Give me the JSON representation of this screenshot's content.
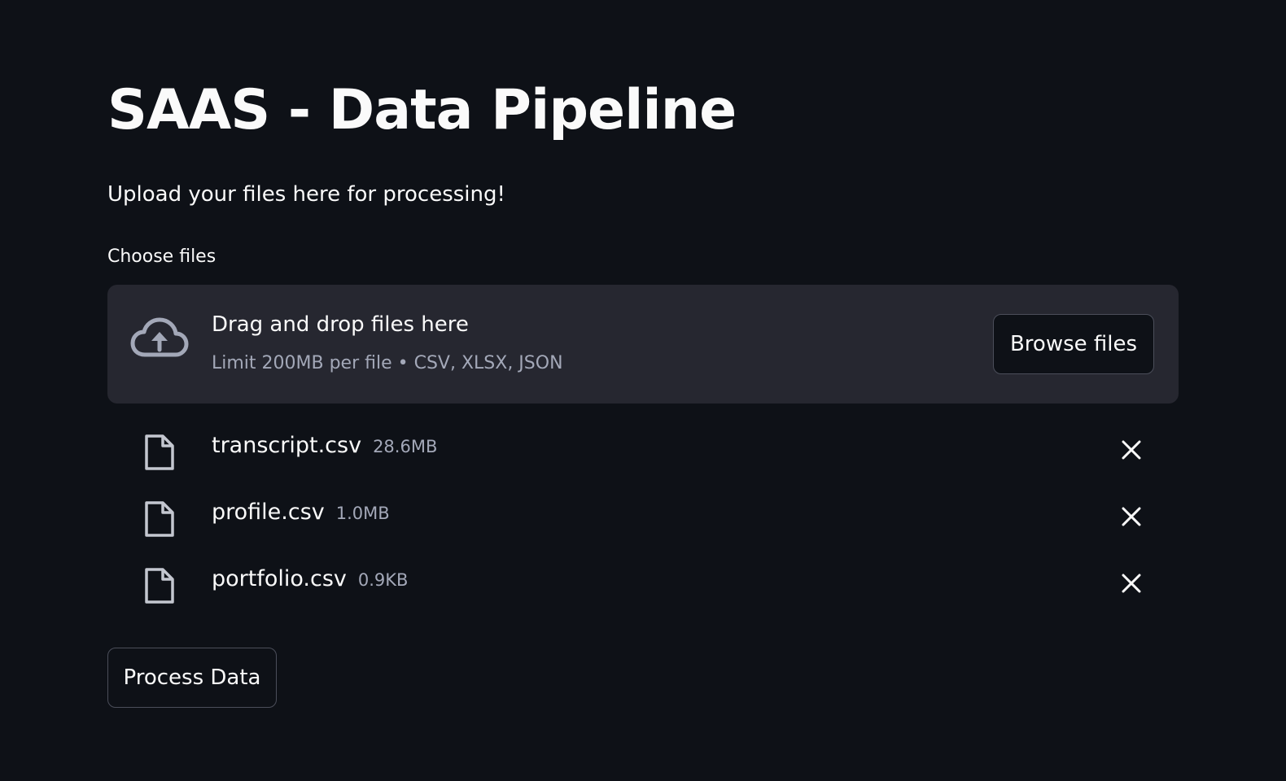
{
  "page": {
    "title": "SAAS - Data Pipeline",
    "subtitle": "Upload your files here for processing!"
  },
  "uploader": {
    "label": "Choose files",
    "dropzone_primary": "Drag and drop files here",
    "dropzone_secondary": "Limit 200MB per file • CSV, XLSX, JSON",
    "browse_label": "Browse files",
    "upload_icon": "cloud-upload-icon"
  },
  "files": [
    {
      "name": "transcript.csv",
      "size": "28.6MB",
      "icon": "file-icon",
      "remove_icon": "close-icon"
    },
    {
      "name": "profile.csv",
      "size": "1.0MB",
      "icon": "file-icon",
      "remove_icon": "close-icon"
    },
    {
      "name": "portfolio.csv",
      "size": "0.9KB",
      "icon": "file-icon",
      "remove_icon": "close-icon"
    }
  ],
  "actions": {
    "process_label": "Process Data"
  },
  "colors": {
    "background": "#0e1117",
    "dropzone": "#262730",
    "text": "#fafafa",
    "muted_text": "#a3a8b8",
    "button_border": "#4b4e5a"
  }
}
